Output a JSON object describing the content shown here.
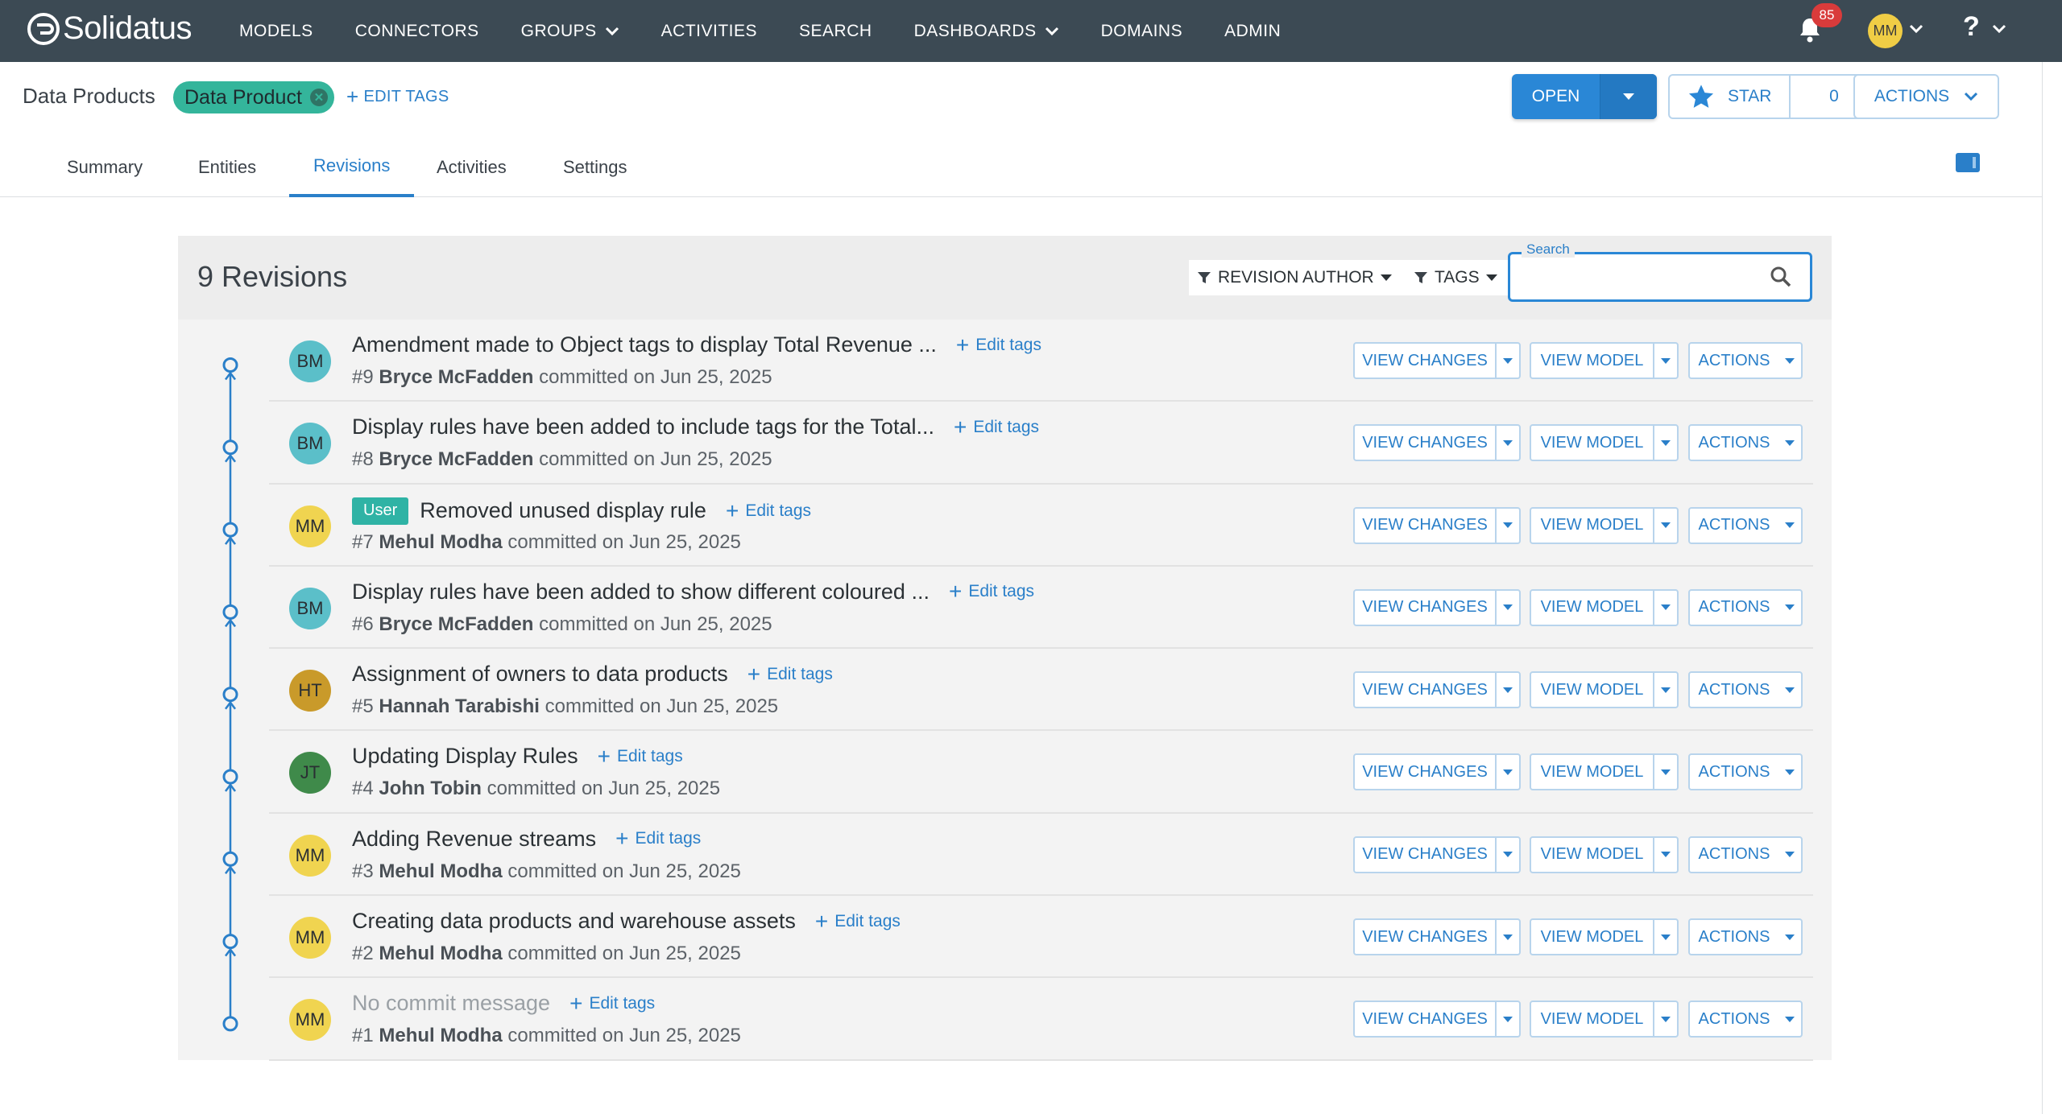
{
  "app": {
    "logo_text": "Solidatus",
    "nav": [
      {
        "label": "MODELS",
        "dropdown": false
      },
      {
        "label": "CONNECTORS",
        "dropdown": false
      },
      {
        "label": "GROUPS",
        "dropdown": true
      },
      {
        "label": "ACTIVITIES",
        "dropdown": false
      },
      {
        "label": "SEARCH",
        "dropdown": false
      },
      {
        "label": "DASHBOARDS",
        "dropdown": true
      },
      {
        "label": "DOMAINS",
        "dropdown": false
      },
      {
        "label": "ADMIN",
        "dropdown": false
      }
    ],
    "notification_count": "85",
    "user_initials": "MM",
    "help_label": "?"
  },
  "header": {
    "title": "Data Products",
    "tag": "Data Product",
    "edit_tags": "EDIT TAGS",
    "open_label": "OPEN",
    "star_label": "STAR",
    "star_count": "0",
    "actions_label": "ACTIONS"
  },
  "tabs": [
    {
      "label": "Summary",
      "active": false
    },
    {
      "label": "Entities",
      "active": false
    },
    {
      "label": "Revisions",
      "active": true
    },
    {
      "label": "Activities",
      "active": false
    },
    {
      "label": "Settings",
      "active": false
    }
  ],
  "revisions": {
    "count_label": "9 Revisions",
    "filter_author": "REVISION AUTHOR",
    "filter_tags": "TAGS",
    "search_label": "Search",
    "search_value": "",
    "buttons": {
      "view_changes": "VIEW CHANGES",
      "view_model": "VIEW MODEL",
      "actions": "ACTIONS"
    },
    "edit_tags_label": "Edit tags",
    "items": [
      {
        "initials": "BM",
        "avatar_color": "#5bbfc9",
        "badge": "",
        "message": "Amendment made to Object tags to display Total Revenue ...",
        "muted": false,
        "number": "#9",
        "author": "Bryce McFadden",
        "committed": "committed on Jun 25, 2025"
      },
      {
        "initials": "BM",
        "avatar_color": "#5bbfc9",
        "badge": "",
        "message": "Display rules have been added to include tags for the Total...",
        "muted": false,
        "number": "#8",
        "author": "Bryce McFadden",
        "committed": "committed on Jun 25, 2025"
      },
      {
        "initials": "MM",
        "avatar_color": "#f0d450",
        "badge": "User",
        "message": "Removed unused display rule",
        "muted": false,
        "number": "#7",
        "author": "Mehul Modha",
        "committed": "committed on Jun 25, 2025"
      },
      {
        "initials": "BM",
        "avatar_color": "#5bbfc9",
        "badge": "",
        "message": "Display rules have been added to show different coloured ...",
        "muted": false,
        "number": "#6",
        "author": "Bryce McFadden",
        "committed": "committed on Jun 25, 2025"
      },
      {
        "initials": "HT",
        "avatar_color": "#c99a2a",
        "badge": "",
        "message": "Assignment of owners to data products",
        "muted": false,
        "number": "#5",
        "author": "Hannah Tarabishi",
        "committed": "committed on Jun 25, 2025"
      },
      {
        "initials": "JT",
        "avatar_color": "#3f8a4a",
        "badge": "",
        "message": "Updating Display Rules",
        "muted": false,
        "number": "#4",
        "author": "John Tobin",
        "committed": "committed on Jun 25, 2025"
      },
      {
        "initials": "MM",
        "avatar_color": "#f0d450",
        "badge": "",
        "message": "Adding Revenue streams",
        "muted": false,
        "number": "#3",
        "author": "Mehul Modha",
        "committed": "committed on Jun 25, 2025"
      },
      {
        "initials": "MM",
        "avatar_color": "#f0d450",
        "badge": "",
        "message": "Creating data products and warehouse assets",
        "muted": false,
        "number": "#2",
        "author": "Mehul Modha",
        "committed": "committed on Jun 25, 2025"
      },
      {
        "initials": "MM",
        "avatar_color": "#f0d450",
        "badge": "",
        "message": "No commit message",
        "muted": true,
        "number": "#1",
        "author": "Mehul Modha",
        "committed": "committed on Jun 25, 2025"
      }
    ]
  }
}
